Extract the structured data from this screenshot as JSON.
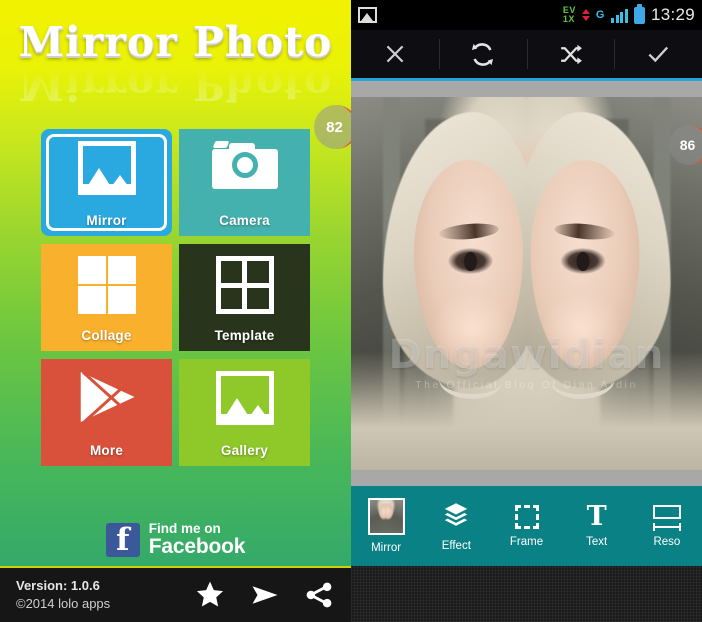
{
  "left_screen": {
    "app_title": "Mirror Photo",
    "badge": "82",
    "tiles": [
      {
        "label": "Mirror",
        "icon": "photo-frame-icon",
        "color": "#29a9e0"
      },
      {
        "label": "Camera",
        "icon": "camera-icon",
        "color": "#45b1ae"
      },
      {
        "label": "Collage",
        "icon": "grid-four-icon",
        "color": "#f9b02c"
      },
      {
        "label": "Template",
        "icon": "grid-outline-icon",
        "color": "#28341c"
      },
      {
        "label": "More",
        "icon": "play-store-icon",
        "color": "#d9513a"
      },
      {
        "label": "Gallery",
        "icon": "photo-frame-icon",
        "color": "#8fc829"
      }
    ],
    "facebook": {
      "line1": "Find me on",
      "line2": "Facebook",
      "badge_letter": "f",
      "badge_color": "#3b5998"
    },
    "footer": {
      "version": "Version: 1.0.6",
      "copyright": "©2014 lolo apps",
      "icons": [
        "star-icon",
        "send-icon",
        "share-icon"
      ]
    }
  },
  "right_screen": {
    "statusbar": {
      "photo_icon": "image-icon",
      "network_label_top": "EV",
      "network_label_bottom": "1X",
      "signal_letter": "G",
      "battery_icon": "battery-icon",
      "time": "13:29"
    },
    "toolbar": {
      "buttons": [
        {
          "name": "close-button",
          "icon": "close-icon"
        },
        {
          "name": "rotate-button",
          "icon": "rotate-icon"
        },
        {
          "name": "shuffle-button",
          "icon": "shuffle-icon"
        },
        {
          "name": "confirm-button",
          "icon": "check-icon"
        }
      ],
      "accent_color": "#27a3d8"
    },
    "photo": {
      "badge": "86",
      "watermark_main": "Dngawidian",
      "watermark_sub": "The Official Blog Of Dian Ardin"
    },
    "bottombar": {
      "background": "#0a8184",
      "items": [
        {
          "label": "Mirror",
          "icon": "mirror-thumbnail-icon"
        },
        {
          "label": "Effect",
          "icon": "layers-icon"
        },
        {
          "label": "Frame",
          "icon": "frame-icon"
        },
        {
          "label": "Text",
          "icon": "text-icon"
        },
        {
          "label": "Reso",
          "icon": "resize-icon"
        }
      ]
    }
  }
}
